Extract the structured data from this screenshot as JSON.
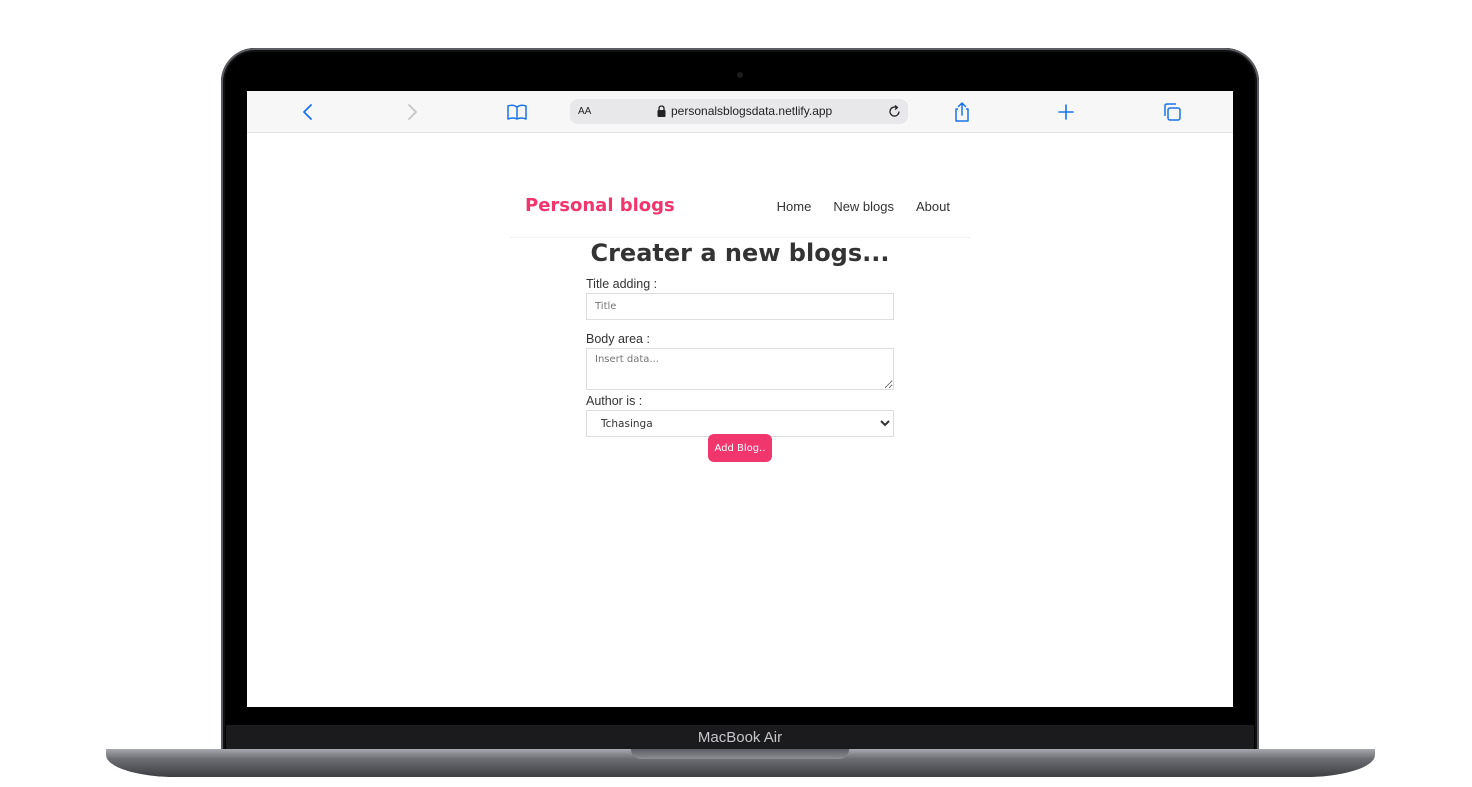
{
  "device": {
    "brand_label": "MacBook Air"
  },
  "browser": {
    "text_size_label": "AA",
    "url": "personalsblogsdata.netlify.app",
    "icons": [
      "back-icon",
      "forward-icon",
      "bookmarks-icon",
      "lock-icon",
      "reload-icon",
      "share-icon",
      "new-tab-icon",
      "tabs-icon"
    ],
    "accent_color": "#1a73e8"
  },
  "page": {
    "site_title": "Personal blogs",
    "nav": {
      "home": "Home",
      "new_blogs": "New blogs",
      "about": "About"
    },
    "heading": "Creater a new blogs...",
    "form": {
      "title_label": "Title adding :",
      "title_placeholder": "Title",
      "title_value": "",
      "body_label": "Body area :",
      "body_placeholder": "Insert data...",
      "body_value": "",
      "author_label": "Author is :",
      "author_selected": "Tchasinga",
      "submit_label": "Add Blog.."
    },
    "brand_color": "#f1356d"
  }
}
